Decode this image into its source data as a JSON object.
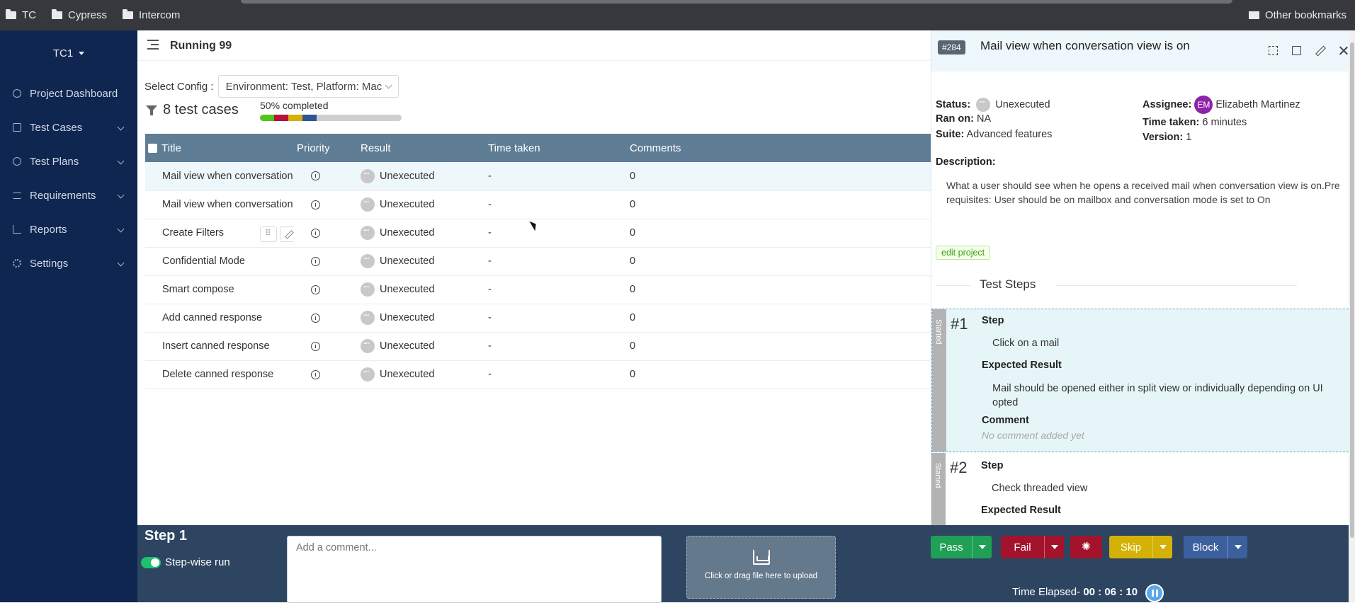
{
  "bookmarks": {
    "items": [
      "TC",
      "Cypress",
      "Intercom"
    ],
    "other": "Other bookmarks"
  },
  "sidebar": {
    "project": "TC1",
    "items": [
      {
        "label": "Project Dashboard",
        "icon": "dashboard-icon",
        "has_submenu": false
      },
      {
        "label": "Test Cases",
        "icon": "edit-icon",
        "has_submenu": true
      },
      {
        "label": "Test Plans",
        "icon": "check-circle-icon",
        "has_submenu": true
      },
      {
        "label": "Requirements",
        "icon": "list-icon",
        "has_submenu": true
      },
      {
        "label": "Reports",
        "icon": "line-chart-icon",
        "has_submenu": true
      },
      {
        "label": "Settings",
        "icon": "gear-icon",
        "has_submenu": true
      }
    ]
  },
  "header": {
    "title": "Running 99"
  },
  "main": {
    "config_label": "Select Config :",
    "config_value": "Environment: Test, Platform: Mac",
    "case_count": "8 test cases",
    "progress_label": "50% completed",
    "progress": [
      {
        "fraction": 0.1,
        "color": "#52c41a"
      },
      {
        "fraction": 0.1,
        "color": "#b5123c"
      },
      {
        "fraction": 0.1,
        "color": "#d4b106"
      },
      {
        "fraction": 0.1,
        "color": "#2f5597"
      }
    ],
    "columns": [
      "Title",
      "Priority",
      "Result",
      "Time taken",
      "Comments"
    ],
    "rows": [
      {
        "title": "Mail view when conversation view is on",
        "result": "Unexecuted",
        "time": "-",
        "comments": "0"
      },
      {
        "title": "Mail view when conversation view is off",
        "result": "Unexecuted",
        "time": "-",
        "comments": "0"
      },
      {
        "title": "Create Filters",
        "result": "Unexecuted",
        "time": "-",
        "comments": "0"
      },
      {
        "title": "Confidential Mode",
        "result": "Unexecuted",
        "time": "-",
        "comments": "0"
      },
      {
        "title": "Smart compose",
        "result": "Unexecuted",
        "time": "-",
        "comments": "0"
      },
      {
        "title": "Add canned response",
        "result": "Unexecuted",
        "time": "-",
        "comments": "0"
      },
      {
        "title": "Insert canned response",
        "result": "Unexecuted",
        "time": "-",
        "comments": "0"
      },
      {
        "title": "Delete canned response",
        "result": "Unexecuted",
        "time": "-",
        "comments": "0"
      }
    ]
  },
  "detail": {
    "badge": "#284",
    "title": "Mail view when conversation view is on",
    "status_label": "Status:",
    "status_value": "Unexecuted",
    "ran_on_label": "Ran on:",
    "ran_on_value": "NA",
    "suite_label": "Suite:",
    "suite_value": "Advanced features",
    "assignee_label": "Assignee:",
    "assignee_initials": "EM",
    "assignee_name": "Elizabeth Martinez",
    "time_taken_label": "Time taken:",
    "time_taken_value": "6 minutes",
    "version_label": "Version:",
    "version_value": "1",
    "description_label": "Description:",
    "description": "What a user should see when he opens a received mail when conversation view is on.Pre requisites: User should be on mailbox and conversation mode is set to On",
    "tag": "edit project",
    "steps_heading": "Test Steps",
    "steps": [
      {
        "number": "#1",
        "state": "Started",
        "step_label": "Step",
        "step": "Click on a mail",
        "expected_label": "Expected Result",
        "expected": "Mail should be opened either in split view or individually depending on UI opted",
        "comment_label": "Comment",
        "comment": "No comment added yet"
      },
      {
        "number": "#2",
        "state": "Started",
        "step_label": "Step",
        "step": "Check threaded view",
        "expected_label": "Expected Result"
      }
    ]
  },
  "bottom": {
    "step_title": "Step 1",
    "stepwise_label": "Step-wise run",
    "comment_placeholder": "Add a comment...",
    "upload_text": "Click or drag file here to upload",
    "pass": "Pass",
    "fail": "Fail",
    "skip": "Skip",
    "block": "Block",
    "elapsed_label": "Time Elapsed-",
    "elapsed_value": "00 : 06 : 10",
    "colors": {
      "pass": "#1fa055",
      "fail": "#a3142c",
      "skip": "#d4b106",
      "block": "#3c5f9e"
    }
  }
}
